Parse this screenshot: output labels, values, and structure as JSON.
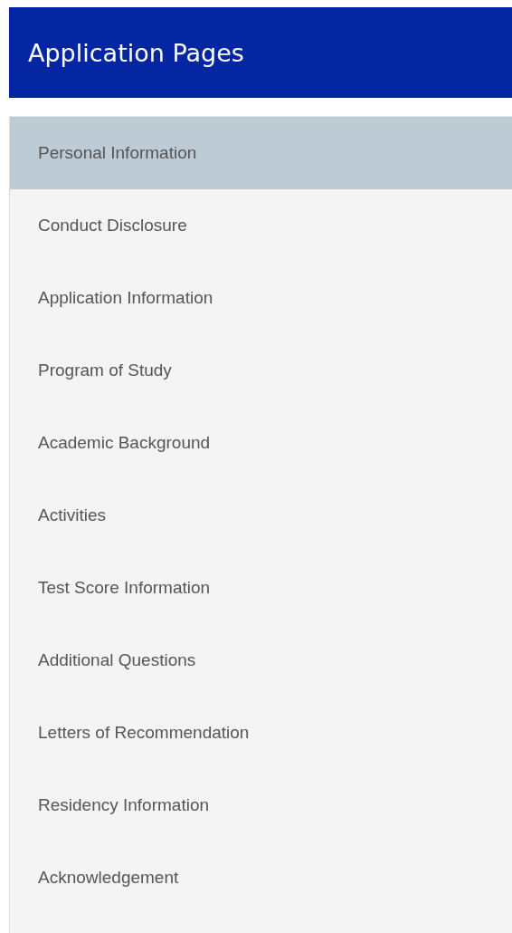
{
  "header": {
    "title": "Application Pages"
  },
  "pages": [
    {
      "label": "Personal Information",
      "selected": true
    },
    {
      "label": "Conduct Disclosure",
      "selected": false
    },
    {
      "label": "Application Information",
      "selected": false
    },
    {
      "label": "Program of Study",
      "selected": false
    },
    {
      "label": "Academic Background",
      "selected": false
    },
    {
      "label": "Activities",
      "selected": false
    },
    {
      "label": "Test Score Information",
      "selected": false
    },
    {
      "label": "Additional Questions",
      "selected": false
    },
    {
      "label": "Letters of Recommendation",
      "selected": false
    },
    {
      "label": "Residency Information",
      "selected": false
    },
    {
      "label": "Acknowledgement",
      "selected": false
    }
  ]
}
